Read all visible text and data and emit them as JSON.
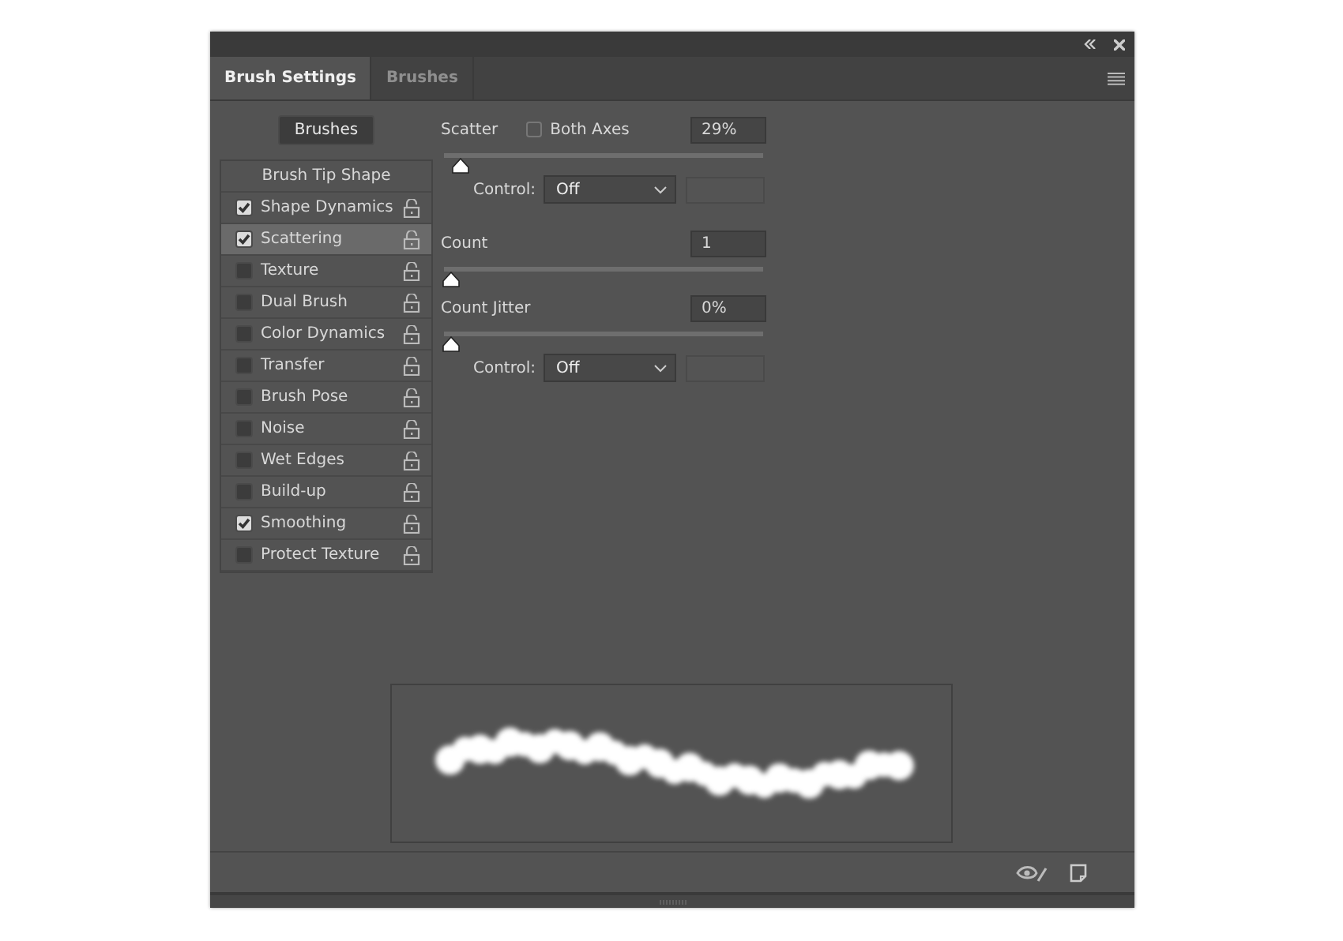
{
  "tabs": [
    {
      "label": "Brush Settings",
      "selected": true
    },
    {
      "label": "Brushes",
      "selected": false
    }
  ],
  "brushes_button": "Brushes",
  "options": [
    {
      "kind": "header",
      "label": "Brush Tip Shape",
      "selected": false
    },
    {
      "kind": "option",
      "label": "Shape Dynamics",
      "checked": true,
      "selected": false
    },
    {
      "kind": "option",
      "label": "Scattering",
      "checked": true,
      "selected": true
    },
    {
      "kind": "option",
      "label": "Texture",
      "checked": false,
      "selected": false
    },
    {
      "kind": "option",
      "label": "Dual Brush",
      "checked": false,
      "selected": false
    },
    {
      "kind": "option",
      "label": "Color Dynamics",
      "checked": false,
      "selected": false
    },
    {
      "kind": "option",
      "label": "Transfer",
      "checked": false,
      "selected": false
    },
    {
      "kind": "option",
      "label": "Brush Pose",
      "checked": false,
      "selected": false
    },
    {
      "kind": "option",
      "label": "Noise",
      "checked": false,
      "selected": false
    },
    {
      "kind": "option",
      "label": "Wet Edges",
      "checked": false,
      "selected": false
    },
    {
      "kind": "option",
      "label": "Build-up",
      "checked": false,
      "selected": false
    },
    {
      "kind": "option",
      "label": "Smoothing",
      "checked": true,
      "selected": false
    },
    {
      "kind": "option",
      "label": "Protect Texture",
      "checked": false,
      "selected": false
    }
  ],
  "settings": [
    {
      "kind": "slider",
      "label": "Scatter",
      "option": {
        "label": "Both Axes",
        "checked": false
      },
      "value": "29%",
      "level": 0.03
    },
    {
      "kind": "control",
      "label": "Control:",
      "value": "Off"
    },
    {
      "kind": "slider",
      "label": "Count",
      "value": "1",
      "level": 0
    },
    {
      "kind": "slider",
      "label": "Count Jitter",
      "value": "0%",
      "level": 0
    },
    {
      "kind": "control",
      "label": "Control:",
      "value": "Off"
    }
  ]
}
